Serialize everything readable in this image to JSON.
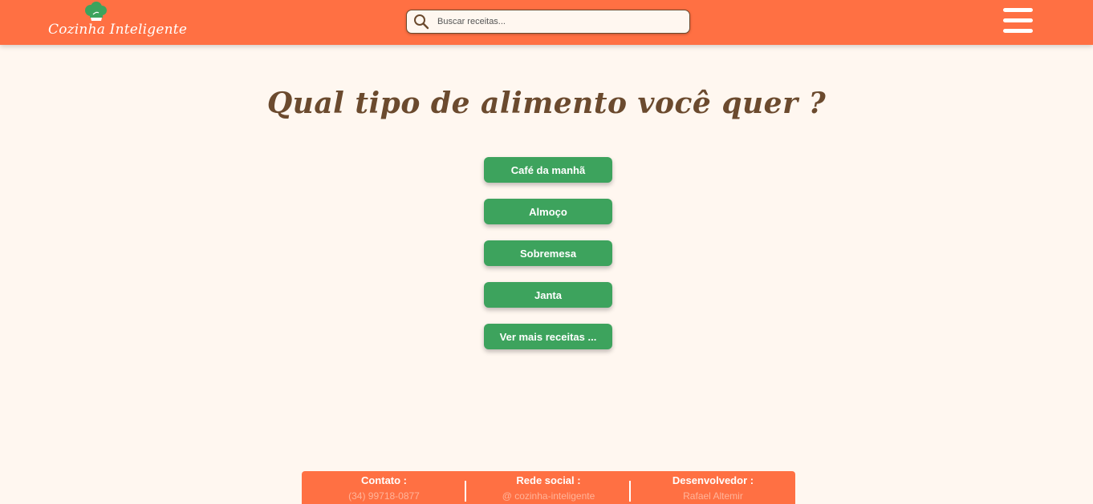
{
  "header": {
    "logo_text": "Cozinha Inteligente",
    "search_placeholder": "Buscar receitas...",
    "search_value": ""
  },
  "main": {
    "title": "Qual tipo de alimento você quer ?",
    "buttons": [
      "Café da manhã",
      "Almoço",
      "Sobremesa",
      "Janta",
      "Ver mais receitas ..."
    ]
  },
  "footer": {
    "columns": [
      {
        "title": "Contato :",
        "value": "(34) 99718-0877"
      },
      {
        "title": "Rede social :",
        "value": "@ cozinha-inteligente"
      },
      {
        "title": "Desenvolvedor :",
        "value": "Rafael Altemir"
      }
    ]
  },
  "colors": {
    "header_bg": "#ff7043",
    "page_bg": "#fff7f0",
    "button_bg": "#3da35d",
    "title_text": "#6b4a2e"
  },
  "icons": [
    "chef-hat-icon",
    "search-icon",
    "hamburger-menu-icon"
  ]
}
